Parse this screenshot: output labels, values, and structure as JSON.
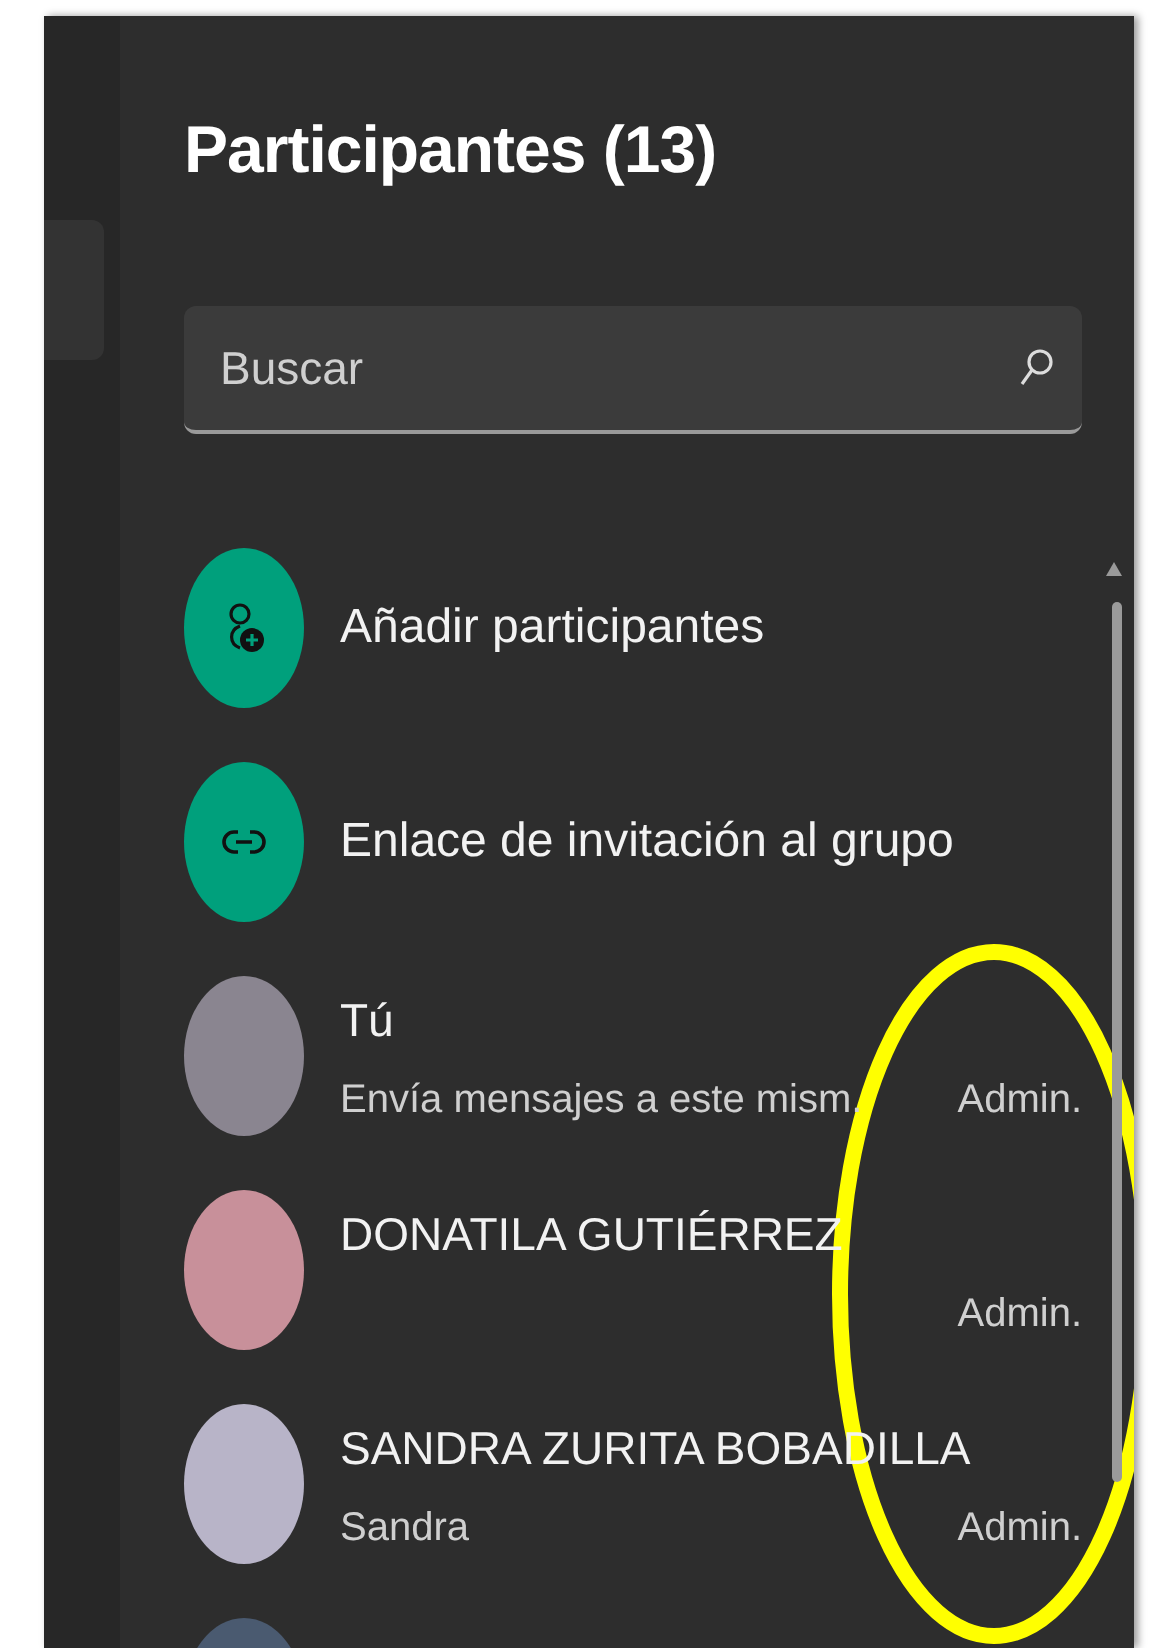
{
  "panel": {
    "title": "Participantes (13)",
    "search": {
      "placeholder": "Buscar"
    },
    "actions": [
      {
        "kind": "add",
        "label": "Añadir participantes"
      },
      {
        "kind": "link",
        "label": "Enlace de invitación al grupo"
      }
    ],
    "participants": [
      {
        "name": "Tú",
        "subtitle": "Envía mensajes a este mism.",
        "role": "Admin."
      },
      {
        "name": "DONATILA GUTIÉRREZ",
        "role": "Admin."
      },
      {
        "name": "SANDRA ZURITA BOBADILLA",
        "subtitle": "Sandra",
        "role": "Admin."
      },
      {
        "cut_off": true
      }
    ]
  }
}
